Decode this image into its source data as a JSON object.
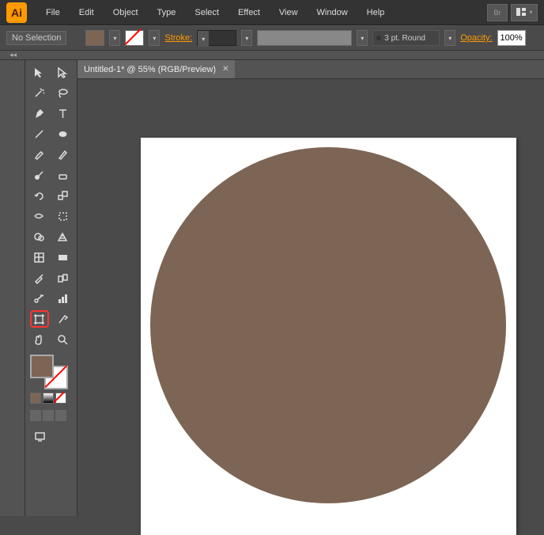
{
  "app": {
    "logo": "Ai"
  },
  "menu": [
    "File",
    "Edit",
    "Object",
    "Type",
    "Select",
    "Effect",
    "View",
    "Window",
    "Help"
  ],
  "controlbar": {
    "selection": "No Selection",
    "stroke_label": "Stroke:",
    "stroke_value": "",
    "style_preset": "3 pt. Round",
    "opacity_label": "Opacity:",
    "opacity_value": "100%"
  },
  "document": {
    "tab_title": "Untitled-1* @ 55% (RGB/Preview)"
  },
  "titlebar_icons": {
    "br": "Br"
  }
}
